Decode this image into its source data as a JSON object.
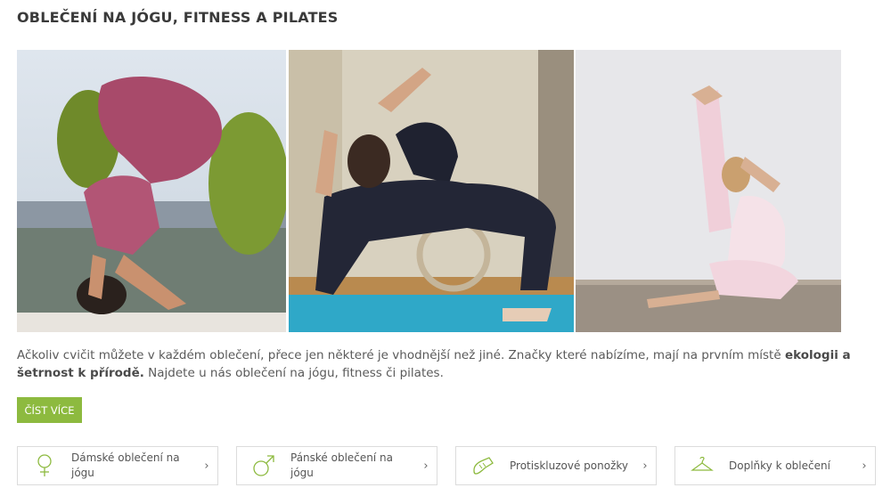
{
  "section": {
    "title": "OBLEČENÍ NA JÓGU, FITNESS A PILATES"
  },
  "description": {
    "text_before": "Ačkoliv cvičit můžete v každém oblečení, přece jen některé je vhodnější než jiné. Značky které nabízíme, mají na prvním místě ",
    "bold": "ekologii a šetrnost k přírodě.",
    "text_after": " Najdete u nás oblečení na jógu, fitness či pilates."
  },
  "read_more_label": "ČÍST VÍCE",
  "categories": [
    {
      "label": "Dámské oblečení na jógu",
      "icon": "female-symbol-icon"
    },
    {
      "label": "Pánské oblečení na jógu",
      "icon": "male-symbol-icon"
    },
    {
      "label": "Protiskluzové ponožky",
      "icon": "sock-icon"
    },
    {
      "label": "Doplňky k oblečení",
      "icon": "hanger-icon"
    }
  ],
  "colors": {
    "accent": "#8dba3f",
    "icon": "#8dba3f",
    "title": "#3a3a3a"
  }
}
